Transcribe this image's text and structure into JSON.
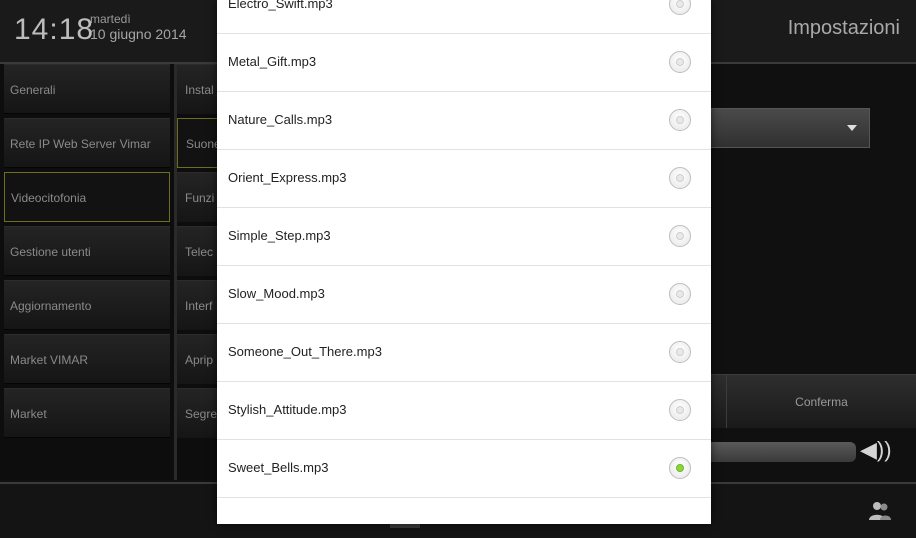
{
  "header": {
    "time": "14:18",
    "weekday": "martedì",
    "date": "10 giugno 2014",
    "title": "Impostazioni"
  },
  "menu": {
    "items": [
      {
        "label": "Generali",
        "selected": false
      },
      {
        "label": "Rete IP Web Server Vimar",
        "selected": false
      },
      {
        "label": "Videocitofonia",
        "selected": true
      },
      {
        "label": "Gestione utenti",
        "selected": false
      },
      {
        "label": "Aggiornamento",
        "selected": false
      },
      {
        "label": "Market VIMAR",
        "selected": false
      },
      {
        "label": "Market",
        "selected": false
      }
    ]
  },
  "submenu": {
    "items": [
      {
        "label": "Instal",
        "selected": false
      },
      {
        "label": "Suone",
        "selected": true
      },
      {
        "label": "Funzi",
        "selected": false
      },
      {
        "label": "Telec",
        "selected": false
      },
      {
        "label": "Interf",
        "selected": false
      },
      {
        "label": "Aprip",
        "selected": false
      },
      {
        "label": "Segre",
        "selected": false
      }
    ]
  },
  "content": {
    "confirm_label": "Conferma"
  },
  "ringtones": {
    "selected": "Sweet_Bells.mp3",
    "items": [
      "Electro_Swift.mp3",
      "Metal_Gift.mp3",
      "Nature_Calls.mp3",
      "Orient_Express.mp3",
      "Simple_Step.mp3",
      "Slow_Mood.mp3",
      "Someone_Out_There.mp3",
      "Stylish_Attitude.mp3",
      "Sweet_Bells.mp3"
    ]
  },
  "icons": {
    "dropdown": "chevron-down-icon",
    "volume": "volume-icon",
    "users": "users-icon"
  },
  "colors": {
    "selection_border": "#6e6e1f",
    "radio_selected": "#8bd53c"
  }
}
